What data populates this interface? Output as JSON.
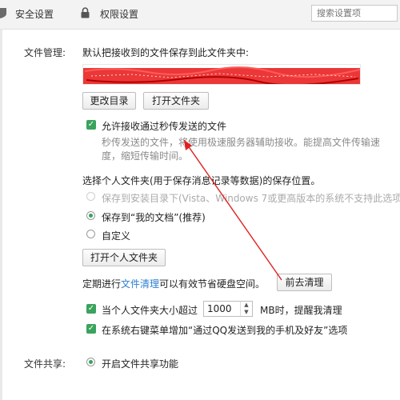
{
  "topbar": {
    "tab_security": "安全设置",
    "tab_permissions": "权限设置",
    "search_placeholder": "搜索设置项"
  },
  "file_management": {
    "label": "文件管理:",
    "save_desc": "默认把接收到的文件保存到此文件夹中:",
    "change_dir_button": "更改目录",
    "open_folder_button": "打开文件夹",
    "allow_flash_transfer": "允许接收通过秒传发送的文件",
    "flash_desc_line1": "秒传发送的文件，将使用极速服务器辅助接收。能提高文件传输速",
    "flash_desc_line2": "度，缩短传输时间。",
    "personal_folder_title": "选择个人文件夹(用于保存消息记录等数据)的保存位置。",
    "radio_install_dir": "保存到安装目录下(Vista、Windows 7或更高版本的系统不支持此选项",
    "radio_my_docs": "保存到“我的文档”(推荐)",
    "radio_custom": "自定义",
    "open_personal_folder_button": "打开个人文件夹",
    "cleanup_prefix": "定期进行",
    "cleanup_link": "文件清理",
    "cleanup_suffix": "可以有效节省硬盘空间。",
    "cleanup_button": "前去清理",
    "size_limit_prefix": "当个人文件夹大小超过",
    "size_limit_value": "1000",
    "size_limit_suffix": "MB时，提醒我清理",
    "context_menu_option": "在系统右键菜单增加“通过QQ发送到我的手机及好友”选项"
  },
  "file_sharing": {
    "label": "文件共享:",
    "enable_sharing": "开启文件共享功能"
  },
  "colors": {
    "accent_green": "#3aa35c",
    "link_blue": "#2a7fd1",
    "annotation_red": "#e02020"
  },
  "icons": [
    "shield-icon",
    "lock-icon",
    "checkbox-checked-icon",
    "radio-icon",
    "spinner-arrows-icon"
  ]
}
